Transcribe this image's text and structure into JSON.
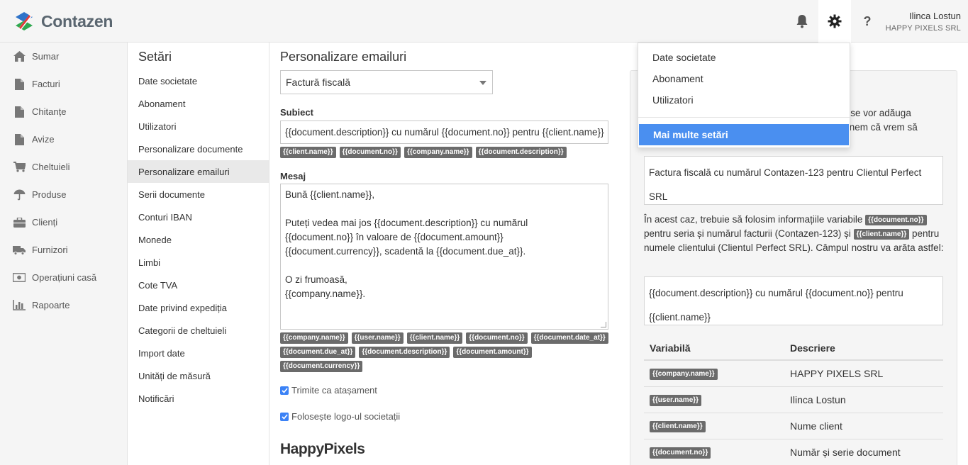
{
  "header": {
    "brand": "Contazen",
    "help_symbol": "?",
    "user_name": "Ilinca Lostun",
    "user_company": "HAPPY PIXELS SRL"
  },
  "nav": [
    {
      "label": "Sumar",
      "icon": "home-icon"
    },
    {
      "label": "Facturi",
      "icon": "file-icon"
    },
    {
      "label": "Chitanțe",
      "icon": "file-icon"
    },
    {
      "label": "Avize",
      "icon": "file-icon"
    },
    {
      "label": "Cheltuieli",
      "icon": "cart-icon"
    },
    {
      "label": "Produse",
      "icon": "umbrella-icon"
    },
    {
      "label": "Clienți",
      "icon": "briefcase-icon"
    },
    {
      "label": "Furnizori",
      "icon": "truck-icon"
    },
    {
      "label": "Operațiuni casă",
      "icon": "money-icon"
    },
    {
      "label": "Rapoarte",
      "icon": "chart-icon"
    }
  ],
  "settings": {
    "title": "Setări",
    "items": [
      "Date societate",
      "Abonament",
      "Utilizatori",
      "Personalizare documente",
      "Personalizare emailuri",
      "Serii documente",
      "Conturi IBAN",
      "Monede",
      "Limbi",
      "Cote TVA",
      "Date privind expediția",
      "Categorii de cheltuieli",
      "Import date",
      "Unități de măsură",
      "Notificări"
    ],
    "active_index": 4
  },
  "main": {
    "title": "Personalizare emailuri",
    "doc_type": "Factură fiscală",
    "subject_label": "Subiect",
    "subject_value": "{{document.description}} cu numărul {{document.no}} pentru {{client.name}}",
    "subject_tags": [
      "{{client.name}}",
      "{{document.no}}",
      "{{company.name}}",
      "{{document.description}}"
    ],
    "message_label": "Mesaj",
    "message_lines": [
      "Bună {{client.name}},",
      "",
      "Puteți vedea mai jos {{document.description}} cu numărul",
      "{{document.no}} în valoare de {{document.amount}}",
      "{{document.currency}}, scadentă la {{document.due_at}}.",
      "",
      "O zi frumoasă,",
      "{{company.name}}."
    ],
    "message_tags": [
      "{{company.name}}",
      "{{user.name}}",
      "{{client.name}}",
      "{{document.no}}",
      "{{document.date_at}}",
      "{{document.due_at}}",
      "{{document.description}}",
      "{{document.amount}}",
      "{{document.currency}}"
    ],
    "attach_label": "Trimite ca atașament",
    "logo_label": "Folosește logo-ul societații",
    "brand_logo": "HappyPixels"
  },
  "help": {
    "intro_line1": "are se vor adăuga",
    "intro_line2": "spunem că vrem să",
    "example1": "Factura fiscală cu numărul Contazen-123 pentru Clientul Perfect SRL",
    "explain_part1": "În acest caz, trebuie să folosim informațiile variabile",
    "explain_tag1": "{{document.no}}",
    "explain_part2": "pentru seria și numărul facturii (Contazen-123) și",
    "explain_tag2": "{{client.name}}",
    "explain_part3": "pentru numele clientului (Clientul Perfect SRL). Câmpul nostru va arăta astfel:",
    "example2": "{{document.description}} cu numărul {{document.no}} pentru {{client.name}}",
    "table_headers": [
      "Variabilă",
      "Descriere"
    ],
    "table_rows": [
      {
        "var": "{{company.name}}",
        "desc": "HAPPY PIXELS SRL"
      },
      {
        "var": "{{user.name}}",
        "desc": "Ilinca Lostun"
      },
      {
        "var": "{{client.name}}",
        "desc": "Nume client"
      },
      {
        "var": "{{document.no}}",
        "desc": "Număr și serie document"
      }
    ]
  },
  "dropdown": {
    "items": [
      "Date societate",
      "Abonament",
      "Utilizatori"
    ],
    "primary": "Mai multe setări"
  }
}
